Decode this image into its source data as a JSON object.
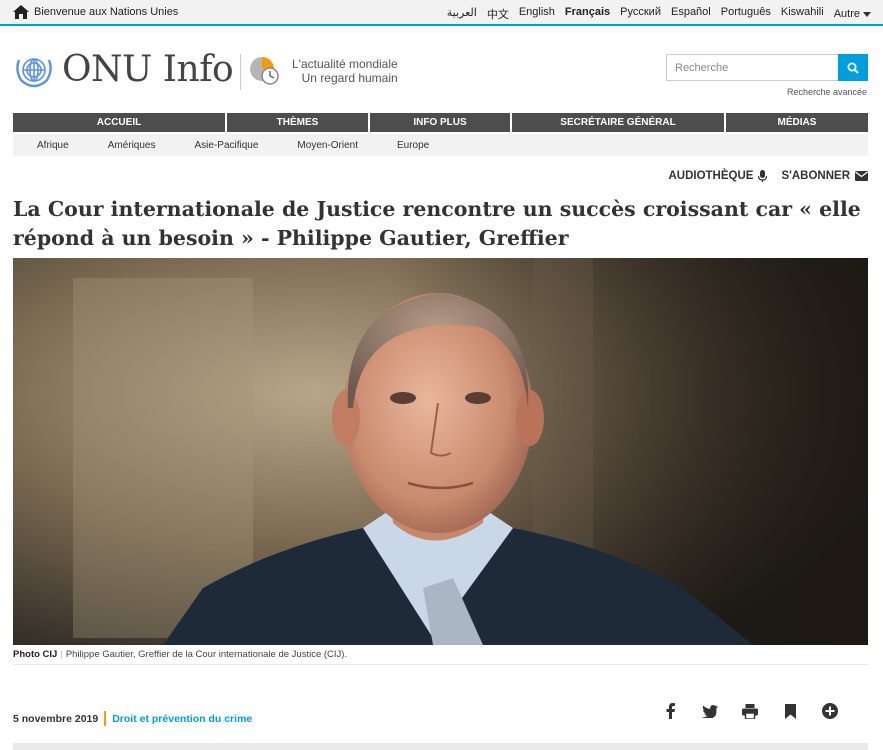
{
  "topbar": {
    "welcome": "Bienvenue aux Nations Unies",
    "languages": [
      "العربية",
      "中文",
      "English",
      "Français",
      "Русский",
      "Español",
      "Português",
      "Kiswahili"
    ],
    "more": "Autre"
  },
  "header": {
    "brand": "ONU Info",
    "tagline_1": "L'actualité mondiale",
    "tagline_2": "Un regard humain",
    "search_placeholder": "Recherche",
    "advanced_search": "Recherche avancée"
  },
  "nav": {
    "main": [
      "ACCUEIL",
      "THÈMES",
      "INFO PLUS",
      "SECRÉTAIRE GÉNÉRAL",
      "MÉDIAS"
    ],
    "regions": [
      "Afrique",
      "Amériques",
      "Asie-Pacifique",
      "Moyen-Orient",
      "Europe"
    ]
  },
  "toolbar": {
    "audio": "AUDIOTHÈQUE",
    "subscribe": "S'ABONNER"
  },
  "article": {
    "title": "La Cour internationale de Justice rencontre un succès croissant car « elle répond à un besoin » - Philippe Gautier, Greffier",
    "photo_credit": "Photo CIJ",
    "photo_caption": "Philippe Gautier, Greffier de la Cour internationale de Justice (CIJ).",
    "date": "5 novembre 2019",
    "topic": "Droit et prévention du crime"
  },
  "colors": {
    "accent": "#009edb",
    "nav_bg": "#4d4d4d",
    "topic_bar": "#f39c12"
  },
  "icons": [
    "home-icon",
    "search-icon",
    "microphone-icon",
    "envelope-icon",
    "facebook-icon",
    "twitter-icon",
    "print-icon",
    "bookmark-icon",
    "plus-circle-icon"
  ]
}
